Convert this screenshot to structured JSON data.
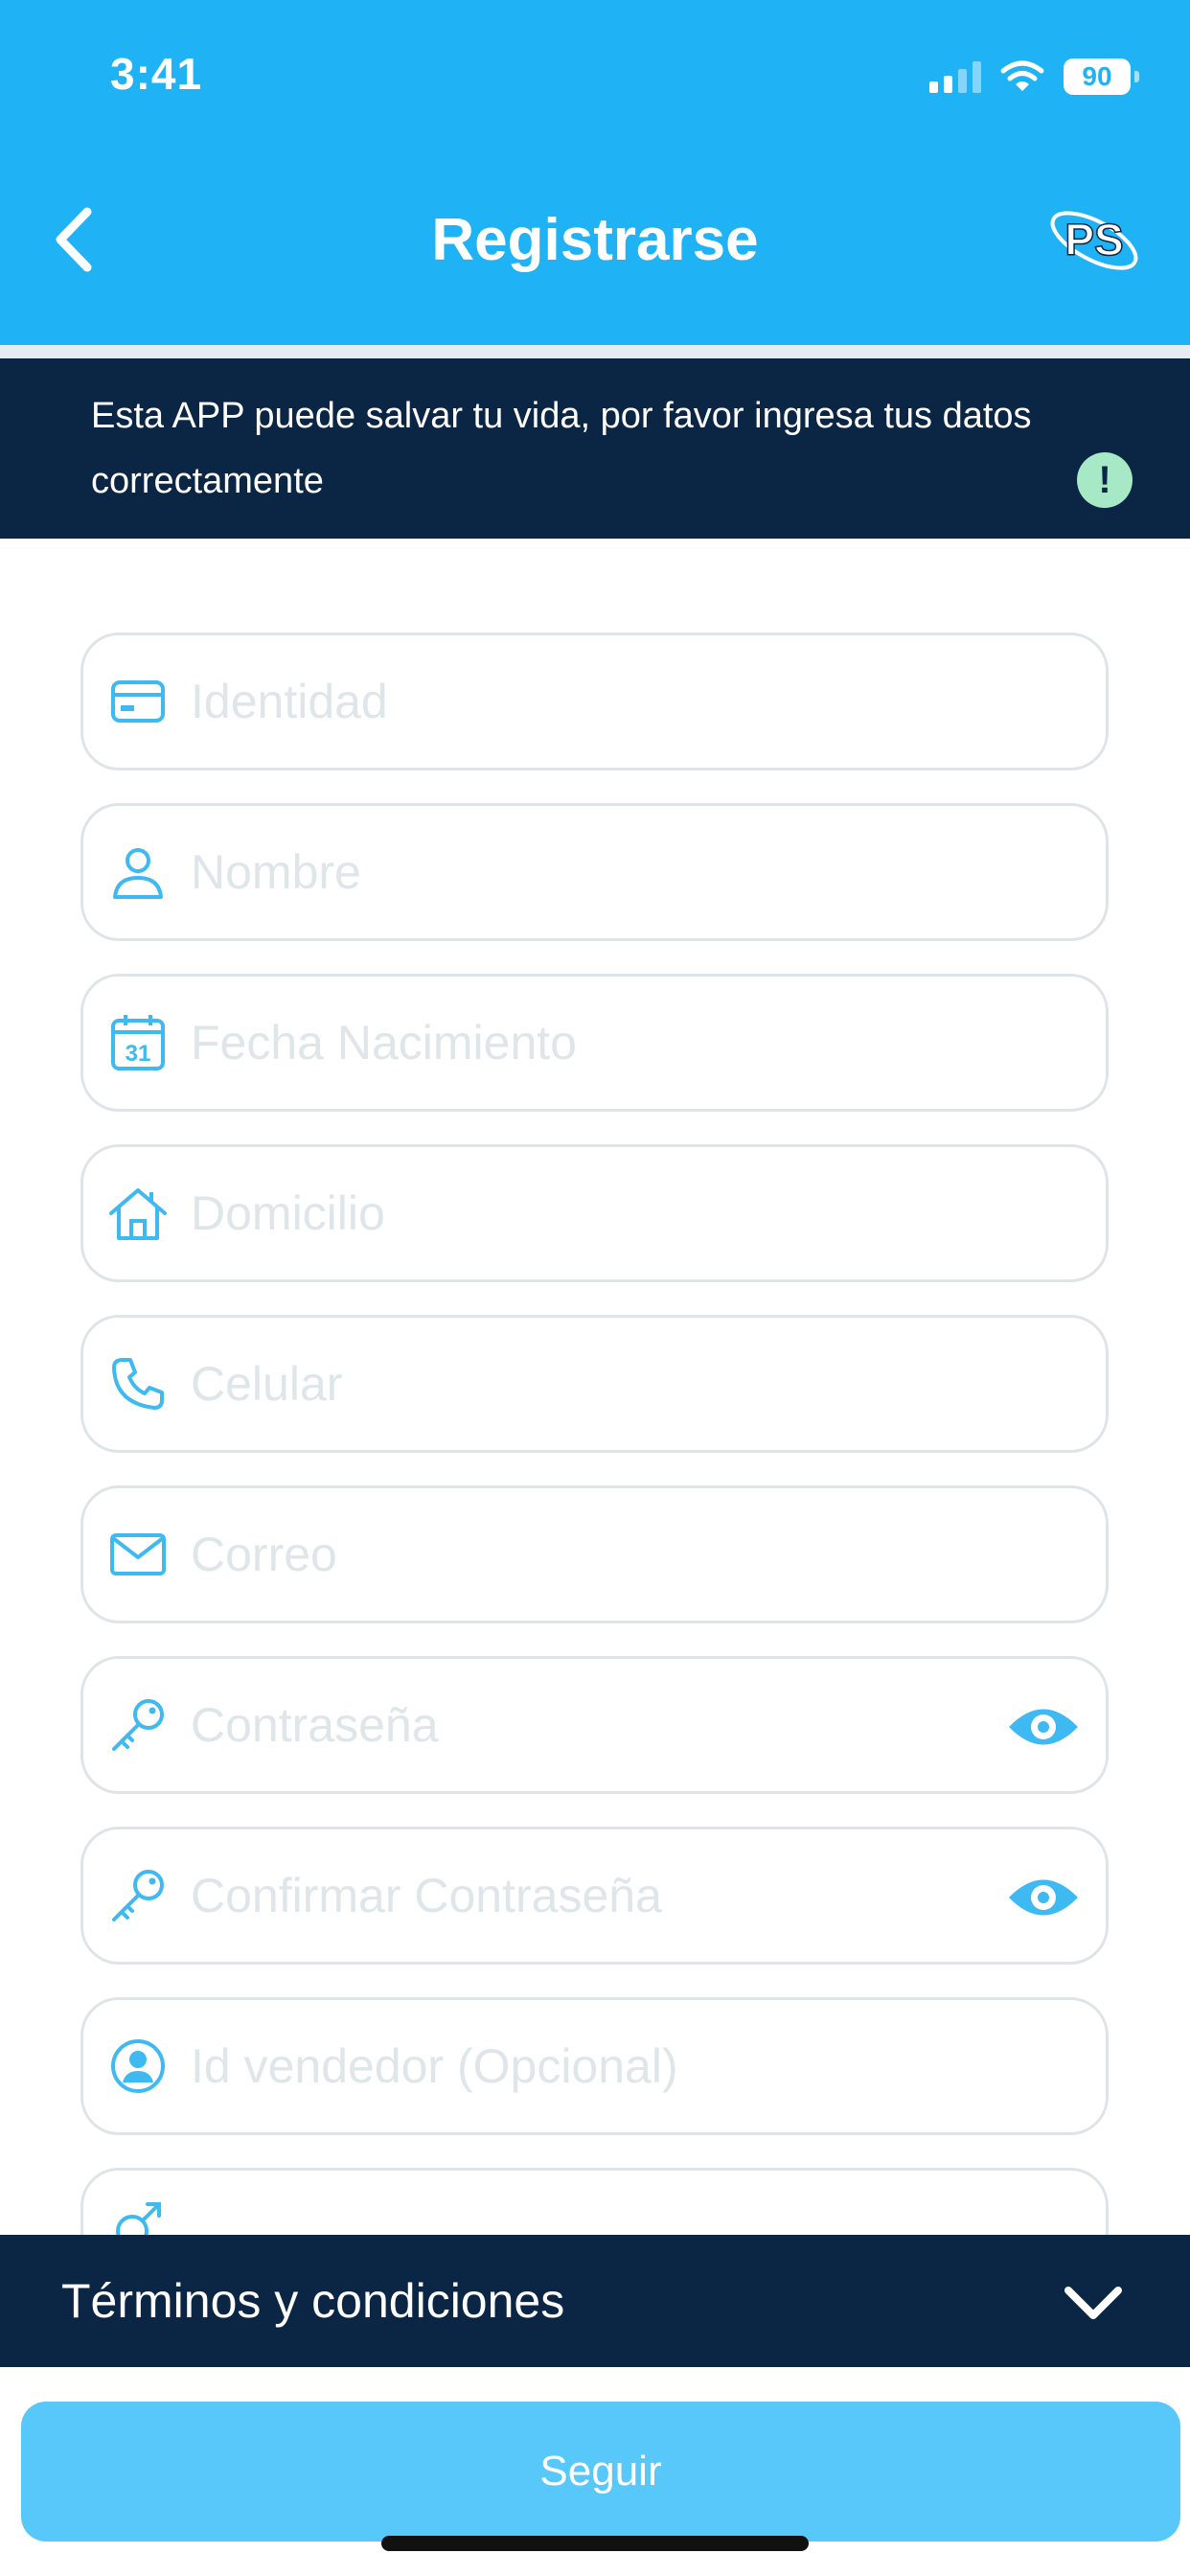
{
  "status_bar": {
    "time": "3:41",
    "battery": "90"
  },
  "header": {
    "title": "Registrarse",
    "logo_text": "PS"
  },
  "banner": {
    "text": "Esta APP puede salvar tu vida, por favor ingresa tus datos correctamente",
    "icon": "!"
  },
  "form": {
    "fields": [
      {
        "icon": "id-card-icon",
        "placeholder": "Identidad"
      },
      {
        "icon": "user-icon",
        "placeholder": "Nombre"
      },
      {
        "icon": "calendar-icon",
        "placeholder": "Fecha Nacimiento",
        "calendar_day": "31"
      },
      {
        "icon": "home-icon",
        "placeholder": "Domicilio"
      },
      {
        "icon": "phone-icon",
        "placeholder": "Celular"
      },
      {
        "icon": "mail-icon",
        "placeholder": "Correo"
      },
      {
        "icon": "key-icon",
        "placeholder": "Contraseña"
      },
      {
        "icon": "key-icon",
        "placeholder": "Confirmar Contraseña"
      },
      {
        "icon": "user-circle-icon",
        "placeholder": "Id vendedor (Opcional)"
      }
    ]
  },
  "terms": {
    "label": "Términos y condiciones"
  },
  "submit": {
    "label": "Seguir"
  },
  "colors": {
    "primary": "#1fb3f5",
    "navy": "#0b2545",
    "button": "#58c8fb",
    "icon": "#3fb9f2"
  }
}
